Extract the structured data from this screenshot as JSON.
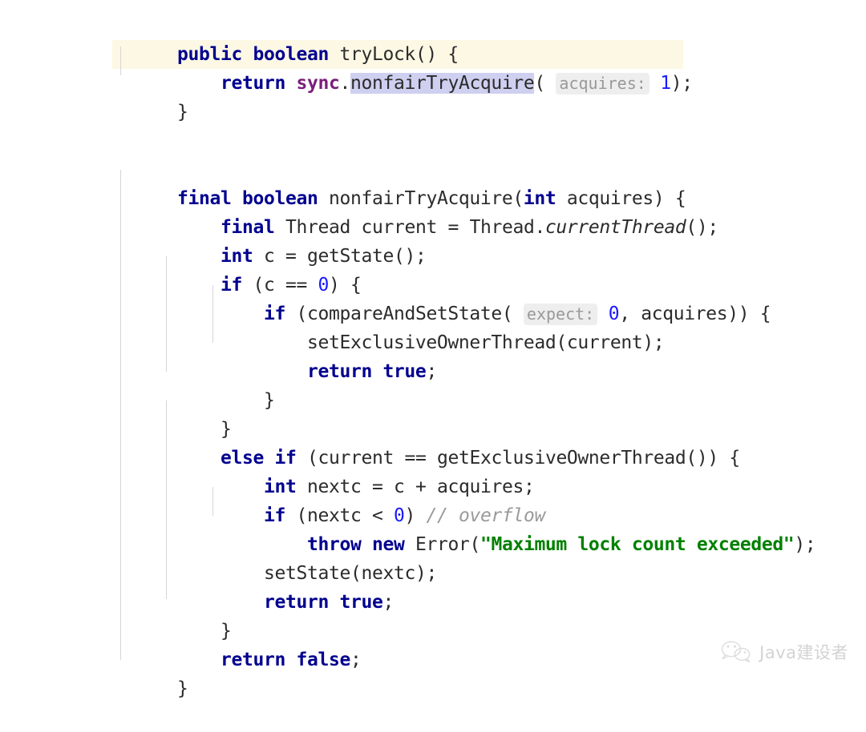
{
  "editor": {
    "language": "java",
    "background": "#ffffff",
    "highlight_line_color": "#fdf8e4",
    "selection_color": "#cfcff0",
    "indent_guide_color": "#d6d6d6",
    "theme_colors": {
      "keyword": "#00008f",
      "number": "#1a1aff",
      "string": "#008000",
      "comment": "#9a9a9a",
      "field": "#7a1f7a",
      "plain": "#2b2b2b",
      "hint_text": "#999999",
      "hint_background": "#eeeeee"
    },
    "lines": [
      {
        "id": "l1",
        "text": "public boolean tryLock() {"
      },
      {
        "id": "l2",
        "text": "    return sync.nonfairTryAcquire( acquires: 1);"
      },
      {
        "id": "l3",
        "text": "}"
      },
      {
        "id": "l4",
        "text": ""
      },
      {
        "id": "l5",
        "text": ""
      },
      {
        "id": "l6",
        "text": "final boolean nonfairTryAcquire(int acquires) {"
      },
      {
        "id": "l7",
        "text": "    final Thread current = Thread.currentThread();"
      },
      {
        "id": "l8",
        "text": "    int c = getState();"
      },
      {
        "id": "l9",
        "text": "    if (c == 0) {"
      },
      {
        "id": "l10",
        "text": "        if (compareAndSetState( expect: 0, acquires)) {"
      },
      {
        "id": "l11",
        "text": "            setExclusiveOwnerThread(current);"
      },
      {
        "id": "l12",
        "text": "            return true;"
      },
      {
        "id": "l13",
        "text": "        }"
      },
      {
        "id": "l14",
        "text": "    }"
      },
      {
        "id": "l15",
        "text": "    else if (current == getExclusiveOwnerThread()) {"
      },
      {
        "id": "l16",
        "text": "        int nextc = c + acquires;"
      },
      {
        "id": "l17",
        "text": "        if (nextc < 0) // overflow"
      },
      {
        "id": "l18",
        "text": "            throw new Error(\"Maximum lock count exceeded\");"
      },
      {
        "id": "l19",
        "text": "        setState(nextc);"
      },
      {
        "id": "l20",
        "text": "        return true;"
      },
      {
        "id": "l21",
        "text": "    }"
      },
      {
        "id": "l22",
        "text": "    return false;"
      },
      {
        "id": "l23",
        "text": "}"
      }
    ],
    "tokens": {
      "kw_public": "public",
      "kw_boolean": "boolean",
      "kw_return": "return",
      "kw_final": "final",
      "kw_int": "int",
      "kw_if": "if",
      "kw_else": "else",
      "kw_new": "new",
      "kw_throw": "throw",
      "kw_true": "true",
      "kw_false": "false",
      "id_tryLock": "tryLock",
      "id_sync": "sync",
      "id_nonfairTryAcquire": "nonfairTryAcquire",
      "id_Thread": "Thread",
      "id_current": "current",
      "id_currentThread": "currentThread",
      "id_getState": "getState",
      "id_c": "c",
      "id_compareAndSetState": "compareAndSetState",
      "id_acquires": "acquires",
      "id_setExclusiveOwnerThread": "setExclusiveOwnerThread",
      "id_getExclusiveOwnerThread": "getExclusiveOwnerThread",
      "id_nextc": "nextc",
      "id_Error": "Error",
      "id_setState": "setState",
      "num_one": "1",
      "num_zero": "0",
      "str_error_message": "\"Maximum lock count exceeded\"",
      "comment_overflow": "// overflow"
    },
    "parameter_hints": [
      {
        "id": "hint-acquires",
        "label": "acquires:",
        "value": "1"
      },
      {
        "id": "hint-expect",
        "label": "expect:",
        "value": "0"
      }
    ],
    "selection": {
      "text": "nonfairTryAcquire",
      "line": "l2"
    }
  },
  "watermark": {
    "icon": "wechat-icon",
    "label": "Java建设者",
    "color": "#b9b9b9"
  }
}
